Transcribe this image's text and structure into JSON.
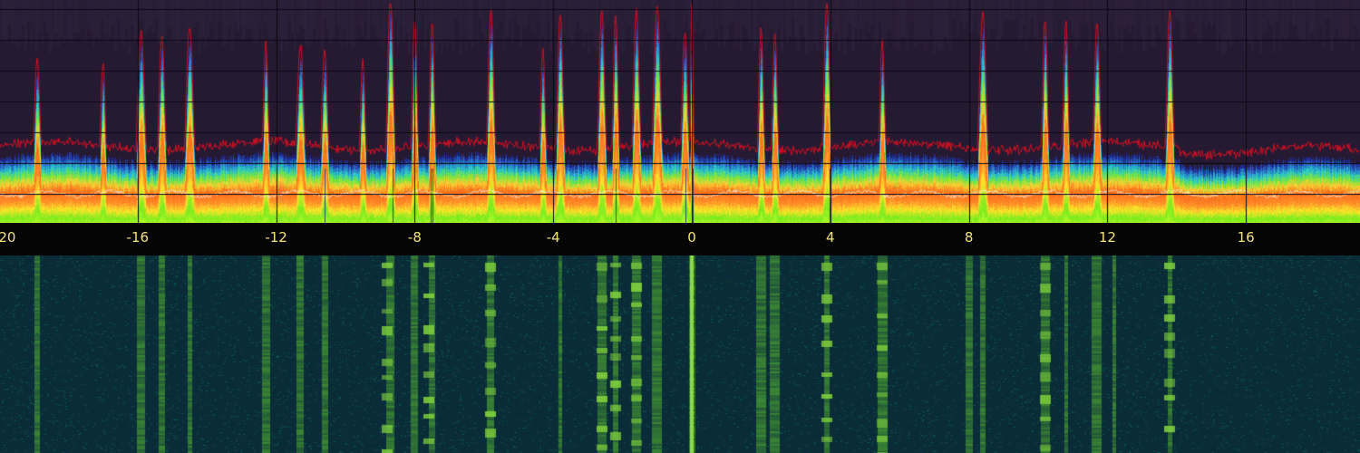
{
  "scale": {
    "ticks": [
      "-20",
      "-16",
      "-12",
      "-8",
      "-4",
      "0",
      "4",
      "8",
      "12",
      "16"
    ],
    "tick_values": [
      -20,
      -16,
      -12,
      -8,
      -4,
      0,
      4,
      8,
      12,
      16
    ]
  },
  "colors": {
    "spectrum_background": "#261a33",
    "grid": "#0c0812",
    "scale_background": "#050505",
    "scale_text": "#f2e27a",
    "peak_hold": "#d01020",
    "waterfall_background": "#0a2c38",
    "waterfall_signal": "#5aa83a"
  },
  "spectrum": {
    "carriers": [
      {
        "f": -18.9,
        "level": 0.68,
        "width": 0.12
      },
      {
        "f": -17.0,
        "level": 0.66,
        "width": 0.1
      },
      {
        "f": -15.9,
        "level": 0.8,
        "width": 0.14
      },
      {
        "f": -15.3,
        "level": 0.79,
        "width": 0.12
      },
      {
        "f": -14.5,
        "level": 0.82,
        "width": 0.14
      },
      {
        "f": -12.3,
        "level": 0.76,
        "width": 0.1
      },
      {
        "f": -11.3,
        "level": 0.74,
        "width": 0.14
      },
      {
        "f": -10.6,
        "level": 0.72,
        "width": 0.12
      },
      {
        "f": -9.5,
        "level": 0.68,
        "width": 0.1
      },
      {
        "f": -8.7,
        "level": 0.96,
        "width": 0.12
      },
      {
        "f": -8.0,
        "level": 0.85,
        "width": 0.1
      },
      {
        "f": -7.5,
        "level": 0.84,
        "width": 0.1
      },
      {
        "f": -5.8,
        "level": 0.9,
        "width": 0.12
      },
      {
        "f": -4.3,
        "level": 0.72,
        "width": 0.1
      },
      {
        "f": -3.8,
        "level": 0.88,
        "width": 0.12
      },
      {
        "f": -2.6,
        "level": 0.9,
        "width": 0.12
      },
      {
        "f": -2.2,
        "level": 0.88,
        "width": 0.1
      },
      {
        "f": -1.6,
        "level": 0.9,
        "width": 0.12
      },
      {
        "f": -1.0,
        "level": 0.92,
        "width": 0.14
      },
      {
        "f": -0.2,
        "level": 0.8,
        "width": 0.12
      },
      {
        "f": 0.0,
        "level": 0.99,
        "width": 0.05
      },
      {
        "f": 2.0,
        "level": 0.82,
        "width": 0.1
      },
      {
        "f": 2.4,
        "level": 0.8,
        "width": 0.1
      },
      {
        "f": 3.9,
        "level": 0.93,
        "width": 0.12
      },
      {
        "f": 5.5,
        "level": 0.76,
        "width": 0.1
      },
      {
        "f": 8.4,
        "level": 0.88,
        "width": 0.14
      },
      {
        "f": 10.2,
        "level": 0.86,
        "width": 0.1
      },
      {
        "f": 10.8,
        "level": 0.85,
        "width": 0.1
      },
      {
        "f": 11.7,
        "level": 0.84,
        "width": 0.12
      },
      {
        "f": 13.8,
        "level": 0.9,
        "width": 0.12
      }
    ]
  },
  "waterfall": {
    "columns": [
      -18.9,
      -15.9,
      -15.3,
      -14.5,
      -12.3,
      -11.3,
      -10.6,
      -8.7,
      -8.0,
      -7.5,
      -5.8,
      -3.8,
      -2.6,
      -2.2,
      -1.6,
      -1.0,
      0.0,
      2.0,
      2.4,
      3.9,
      5.5,
      8.0,
      8.4,
      10.2,
      10.8,
      11.7,
      12.2,
      13.8
    ]
  }
}
